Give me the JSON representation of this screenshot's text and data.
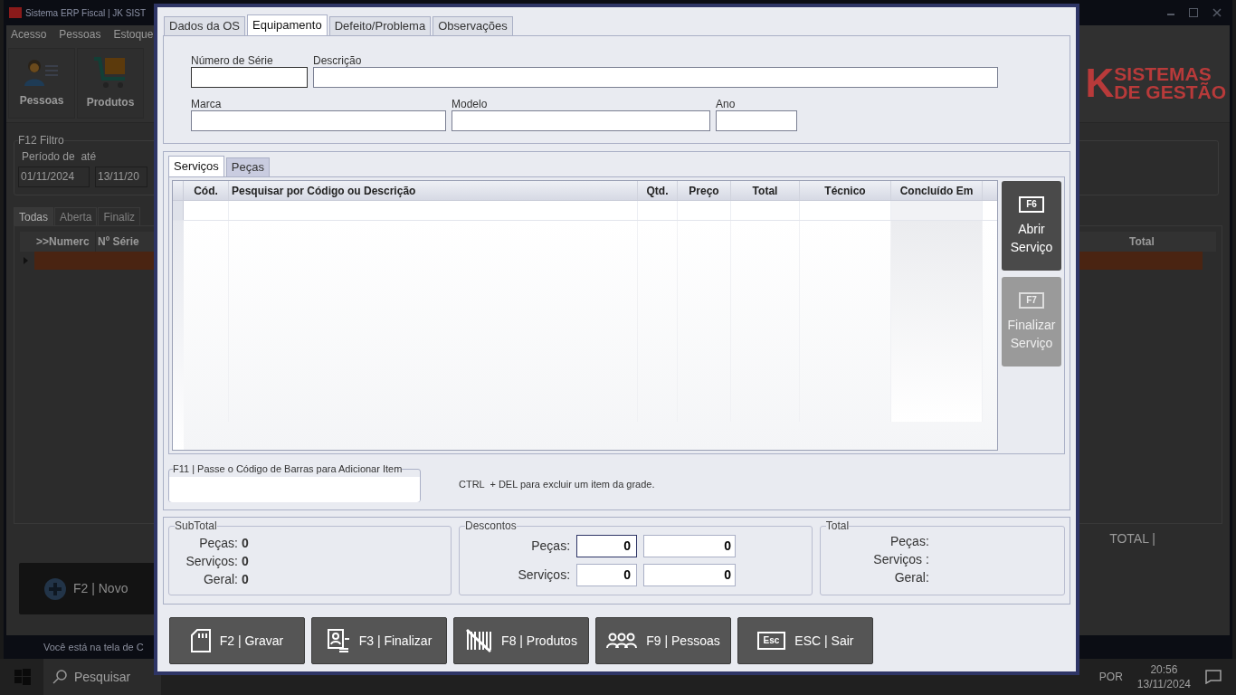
{
  "background_app": {
    "title": "Sistema ERP Fiscal | JK SIST",
    "menu": [
      "Acesso",
      "Pessoas",
      "Estoque"
    ],
    "toolbar": [
      {
        "label": "Pessoas",
        "kind": "person"
      },
      {
        "label": "Produtos",
        "kind": "cart"
      }
    ],
    "logo": {
      "mark": "K",
      "lines": [
        "SISTEMAS",
        "DE GESTÃO"
      ]
    },
    "filter": {
      "legend": "F12 Filtro",
      "period_label": "Período de  até",
      "from": "01/11/2024",
      "to": "13/11/20"
    },
    "tabs": [
      {
        "label": "Todas",
        "selected": true
      },
      {
        "label": "Aberta",
        "selected": false
      },
      {
        "label": "Finaliz",
        "selected": false
      }
    ],
    "grid": {
      "columns": [
        ">>Numerc",
        "Nº Série"
      ],
      "right_column": "Total",
      "row_selected": true
    },
    "total_label": "TOTAL |",
    "new_button": "F2 | Novo",
    "status_text": "Você está na tela de C"
  },
  "dialog": {
    "tabs": [
      {
        "label": "Dados da OS",
        "selected": false
      },
      {
        "label": "Equipamento",
        "selected": true
      },
      {
        "label": "Defeito/Problema",
        "selected": false
      },
      {
        "label": "Observações",
        "selected": false
      }
    ],
    "equipment": {
      "serial_label": "Número de Série",
      "description_label": "Descrição",
      "brand_label": "Marca",
      "model_label": "Modelo",
      "year_label": "Ano"
    },
    "sub_tabs": [
      {
        "label": "Serviços",
        "selected": true
      },
      {
        "label": "Peças",
        "selected": false
      }
    ],
    "grid": {
      "columns": [
        "Cód.",
        "Pesquisar por Código ou Descrição",
        "Qtd.",
        "Preço",
        "Total",
        "Técnico",
        "Concluído Em"
      ]
    },
    "side_buttons": [
      {
        "key": "F6",
        "label": "Abrir Serviço",
        "disabled": false
      },
      {
        "key": "F7",
        "label": "Finalizar Serviço",
        "disabled": true
      }
    ],
    "barcode": {
      "legend": "F11 | Passe o Código de Barras para Adicionar Item"
    },
    "hint": "CTRL  + DEL para excluir um item da grade.",
    "subtotal": {
      "legend": "SubTotal",
      "rows": [
        {
          "label": "Peças:",
          "value": "0"
        },
        {
          "label": "Serviços:",
          "value": "0"
        },
        {
          "label": "Geral:",
          "value": "0"
        }
      ]
    },
    "discounts": {
      "legend": "Descontos",
      "rows": [
        {
          "label": "Peças:",
          "percent": "0",
          "amount": "0",
          "focused": true
        },
        {
          "label": "Serviços:",
          "percent": "0",
          "amount": "0",
          "focused": false
        }
      ]
    },
    "total": {
      "legend": "Total",
      "rows": [
        "Peças:",
        "Serviços :",
        "Geral:"
      ]
    },
    "buttons": [
      {
        "kind": "save",
        "label": "F2 | Gravar"
      },
      {
        "kind": "finish",
        "label": "F3 | Finalizar"
      },
      {
        "kind": "products",
        "label": "F8 | Produtos"
      },
      {
        "kind": "people",
        "label": "F9 | Pessoas"
      },
      {
        "kind": "exit",
        "label": "ESC | Sair",
        "key": "Esc"
      }
    ]
  },
  "taskbar": {
    "search": "Pesquisar",
    "language": "POR",
    "time": "20:56",
    "date": "13/11/2024"
  }
}
